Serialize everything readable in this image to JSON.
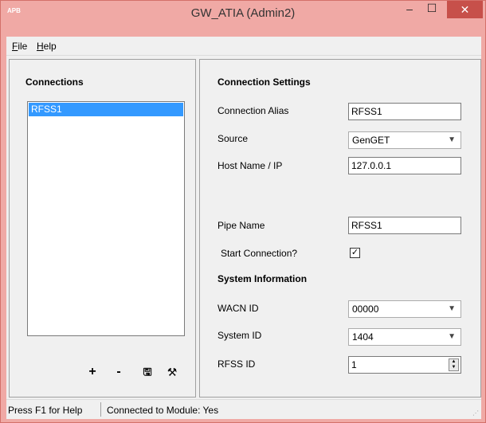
{
  "window": {
    "title": "GW_ATIA (Admin2)",
    "app_icon_text": "APB",
    "minimize_glyph": "–",
    "maximize_glyph": "☐",
    "close_glyph": "✕"
  },
  "menu": {
    "file": {
      "accel": "F",
      "rest": "ile"
    },
    "help": {
      "accel": "H",
      "rest": "elp"
    }
  },
  "connections": {
    "title": "Connections",
    "items": [
      "RFSS1"
    ],
    "toolbar": {
      "add": "+",
      "remove": "-",
      "save": "🖫",
      "settings": "⚒"
    }
  },
  "settings": {
    "title": "Connection Settings",
    "alias_label": "Connection Alias",
    "alias_value": "RFSS1",
    "source_label": "Source",
    "source_value": "GenGET",
    "host_label": "Host Name / IP",
    "host_value": "127.0.0.1",
    "pipe_label": "Pipe Name",
    "pipe_value": "RFSS1",
    "start_label": "Start Connection?",
    "start_checked": "✓"
  },
  "system": {
    "title": "System Information",
    "wacn_label": "WACN ID",
    "wacn_value": "00000",
    "system_label": "System ID",
    "system_value": "1404",
    "rfss_label": "RFSS ID",
    "rfss_value": "1"
  },
  "status": {
    "help": "Press F1 for Help",
    "connection": "Connected to Module: Yes"
  },
  "colors": {
    "titlebar": "#f0a9a5",
    "close_button": "#c7504a",
    "selection": "#3399ff"
  }
}
